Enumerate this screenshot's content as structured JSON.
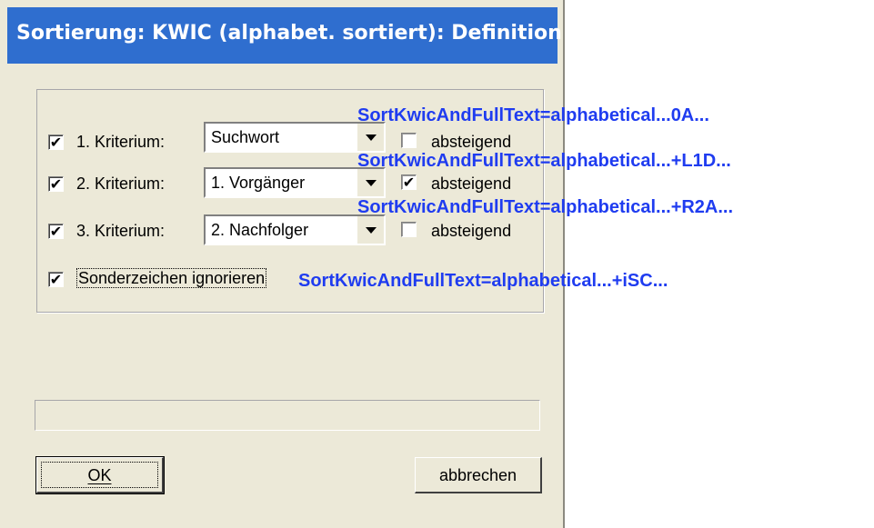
{
  "dialog": {
    "title": "Sortierung: KWIC (alphabet. sortiert): Definition",
    "criteria": [
      {
        "checked": true,
        "check_glyph": "✔",
        "label": "1. Kriterium:",
        "value": "Suchwort",
        "desc_checked": false,
        "desc_glyph": "",
        "desc_label": "absteigend"
      },
      {
        "checked": true,
        "check_glyph": "✔",
        "label": "2. Kriterium:",
        "value": "1. Vorgänger",
        "desc_checked": true,
        "desc_glyph": "✔",
        "desc_label": "absteigend"
      },
      {
        "checked": true,
        "check_glyph": "✔",
        "label": "3. Kriterium:",
        "value": "2. Nachfolger",
        "desc_checked": false,
        "desc_glyph": "",
        "desc_label": "absteigend"
      }
    ],
    "ignore_special": {
      "checked": true,
      "check_glyph": "✔",
      "label": "Sonderzeichen ignorieren"
    },
    "buttons": {
      "ok": "OK",
      "cancel": "abbrechen"
    }
  },
  "overlays": [
    "SortKwicAndFullText=alphabetical...0A...",
    "SortKwicAndFullText=alphabetical...+L1D...",
    "SortKwicAndFullText=alphabetical...+R2A...",
    "SortKwicAndFullText=alphabetical...+iSC..."
  ],
  "colors": {
    "titlebar": "#2f6ecf",
    "overlay_text": "#1f3cf0",
    "dialog_bg": "#ece9d8"
  },
  "icons": {
    "dropdown": "chevron-down-icon",
    "check": "checkmark-icon"
  }
}
